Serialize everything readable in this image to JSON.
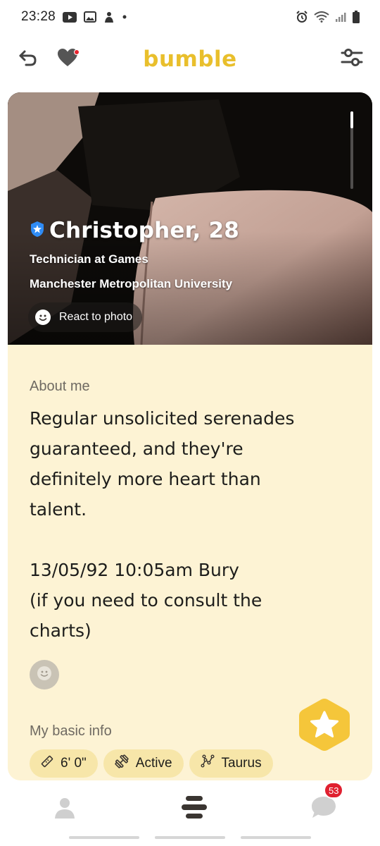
{
  "status_bar": {
    "time": "23:28",
    "left_icons": [
      "youtube-icon",
      "gallery-icon",
      "app-notification-icon"
    ],
    "right_icons": [
      "alarm-icon",
      "wifi-icon",
      "signal-icon",
      "battery-icon"
    ]
  },
  "header": {
    "logo": "bumble",
    "brand_color": "#e9bf2c",
    "left_icons": [
      "undo-icon",
      "heart-icon"
    ],
    "right_icon": "filter-icon"
  },
  "profile": {
    "name_age": "Christopher, 28",
    "verified_icon": "verified-badge-icon",
    "job": "Technician at Games",
    "school": "Manchester Metropolitan University",
    "react_label": "React to photo"
  },
  "about": {
    "label": "About me",
    "text": "Regular unsolicited serenades\nguaranteed, and they're\ndefinitely more heart than\ntalent.\n\n13/05/92 10:05am Bury\n(if you need to consult the\ncharts)"
  },
  "basic_info": {
    "label": "My basic info",
    "chips": [
      {
        "icon": "ruler-icon",
        "label": "6' 0\""
      },
      {
        "icon": "dumbbell-icon",
        "label": "Active"
      },
      {
        "icon": "constellation-icon",
        "label": "Taurus"
      }
    ]
  },
  "bottom_nav": {
    "items": [
      "profile-icon",
      "discover-icon",
      "chat-icon"
    ],
    "chat_badge": "53",
    "badge_color": "#e02030"
  }
}
